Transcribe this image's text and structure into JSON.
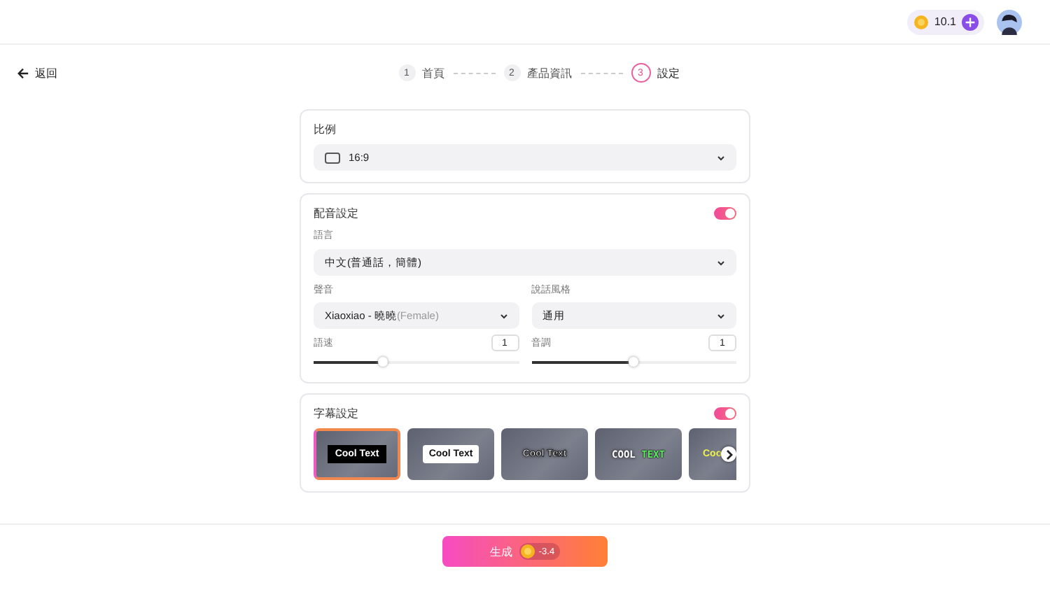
{
  "header": {
    "credits": "10.1"
  },
  "back": {
    "label": "返回"
  },
  "steps": [
    {
      "number": "1",
      "label": "首頁",
      "selected": false
    },
    {
      "number": "2",
      "label": "產品資訊",
      "selected": false
    },
    {
      "number": "3",
      "label": "設定",
      "selected": true
    }
  ],
  "ratio": {
    "title": "比例",
    "value": "16:9"
  },
  "voice": {
    "title": "配音設定",
    "on": true,
    "language_label": "語言",
    "language": "中文(普通話，簡體)",
    "voice_label": "聲音",
    "voice_name": "Xiaoxiao - 曉曉",
    "voice_gender": "(Female)",
    "style_label": "說話風格",
    "style": "通用",
    "speed": {
      "label": "語速",
      "value": "1",
      "level": 0.34
    },
    "pitch": {
      "label": "音調",
      "value": "1",
      "level": 0.5
    }
  },
  "subtitles": {
    "title": "字幕設定",
    "on": true,
    "styles": [
      {
        "kind": "black-box",
        "text": "Cool Text",
        "selected": true
      },
      {
        "kind": "white-box",
        "text": "Cool Text",
        "selected": false
      },
      {
        "kind": "outline",
        "text": "Cool Text",
        "selected": false
      },
      {
        "kind": "two-tone",
        "text": "COOL",
        "text_2": "TEXT",
        "selected": false
      },
      {
        "kind": "yellow",
        "text": "Coo",
        "selected": false
      }
    ]
  },
  "generate": {
    "label": "生成",
    "cost": "-3.4"
  }
}
